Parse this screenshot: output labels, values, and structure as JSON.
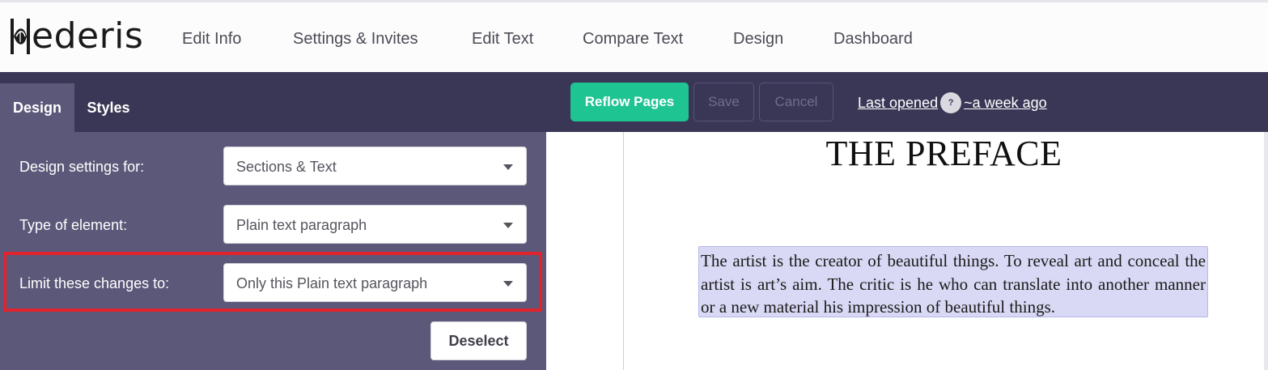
{
  "app": {
    "logo_text": "ederis",
    "logo_icon": "leaf-h-logo-icon"
  },
  "nav": {
    "items": [
      "Edit Info",
      "Settings & Invites",
      "Edit Text",
      "Compare Text",
      "Design",
      "Dashboard"
    ]
  },
  "toolbar": {
    "tabs": [
      "Design",
      "Styles"
    ],
    "active_tab": "Design",
    "reflow_label": "Reflow Pages",
    "save_label": "Save",
    "cancel_label": "Cancel",
    "last_opened_label": "Last opened",
    "help_icon": "?",
    "last_opened_value": "~a week ago"
  },
  "design_panel": {
    "rows": [
      {
        "label": "Design settings for:",
        "value": "Sections & Text"
      },
      {
        "label": "Type of element:",
        "value": "Plain text paragraph"
      },
      {
        "label": "Limit these changes to:",
        "value": "Only this Plain text paragraph"
      }
    ],
    "deselect_label": "Deselect"
  },
  "preview": {
    "heading": "THE PREFACE",
    "paragraph": "The artist is the creator of beautiful things. To reveal art and conceal the artist is art’s aim. The critic is he who can translate into another manner or a new material his impression of beautiful things."
  },
  "colors": {
    "toolbar_bg": "#3a3756",
    "panel_bg": "#5c5879",
    "accent_green": "#1fc493",
    "highlight_red": "#e0232d",
    "selection_bg": "#d9d9f5"
  }
}
